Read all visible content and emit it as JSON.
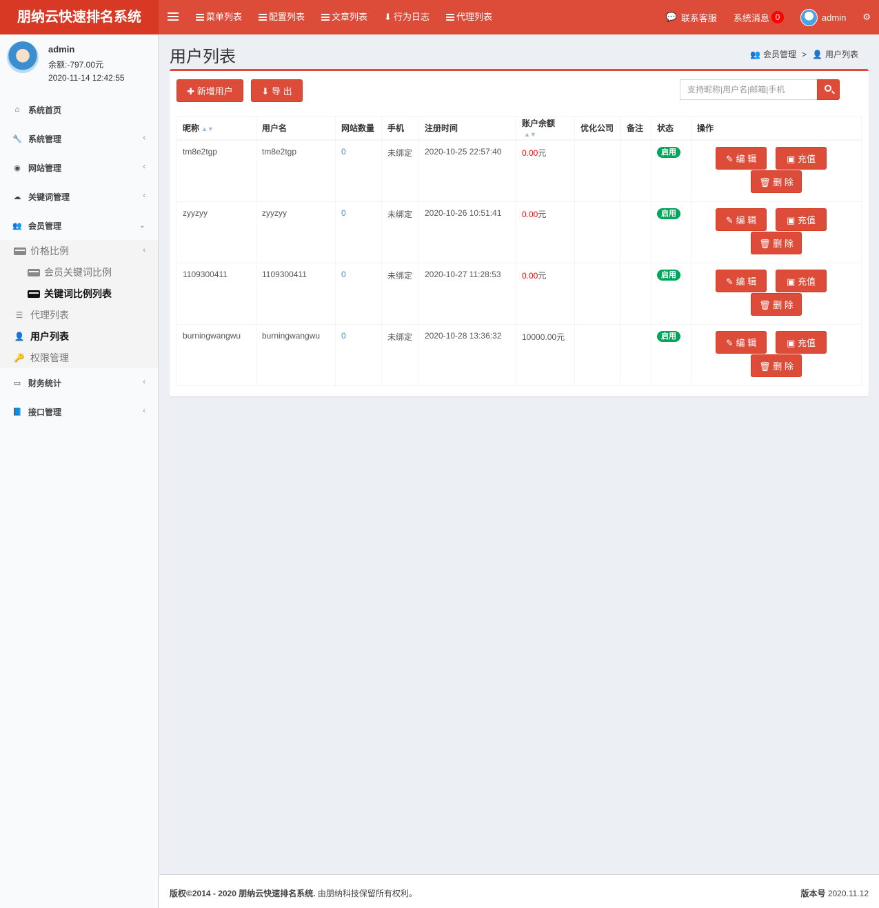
{
  "app": {
    "title": "朋纳云快速排名系统"
  },
  "topnav": {
    "items": [
      {
        "label": "菜单列表",
        "icon": "list-icon"
      },
      {
        "label": "配置列表",
        "icon": "list-icon"
      },
      {
        "label": "文章列表",
        "icon": "list-icon"
      },
      {
        "label": "行为日志",
        "icon": "download-icon"
      },
      {
        "label": "代理列表",
        "icon": "list-icon"
      }
    ],
    "contact": "联系客服",
    "messages": "系统消息",
    "message_count": "0",
    "user": "admin"
  },
  "user_panel": {
    "name": "admin",
    "balance": "余额:-797.00元",
    "time": "2020-11-14 12:42:55"
  },
  "sidebar": {
    "items": [
      {
        "label": "系统首页",
        "icon": "home-icon"
      },
      {
        "label": "系统管理",
        "icon": "wrench-icon"
      },
      {
        "label": "网站管理",
        "icon": "circle-icon"
      },
      {
        "label": "关键词管理",
        "icon": "cloud-icon"
      },
      {
        "label": "会员管理",
        "icon": "users-icon"
      }
    ],
    "member_sub": {
      "price_ratio": "价格比例",
      "member_keyword_ratio": "会员关键词比例",
      "keyword_ratio_list": "关键词比例列表",
      "agent_list": "代理列表",
      "user_list": "用户列表",
      "permission": "权限管理"
    },
    "bottom_items": [
      {
        "label": "财务统计",
        "icon": "card-icon"
      },
      {
        "label": "接口管理",
        "icon": "book-icon"
      }
    ]
  },
  "page": {
    "title": "用户列表",
    "breadcrumb": {
      "parent": "会员管理",
      "current": "用户列表"
    },
    "add_button": "新增用户",
    "export_button": "导 出",
    "search_placeholder": "支持昵称|用户名|邮箱|手机"
  },
  "table": {
    "headers": {
      "nickname": "昵称",
      "username": "用户名",
      "sites": "网站数量",
      "phone": "手机",
      "registered": "注册时间",
      "balance": "账户余额",
      "company": "优化公司",
      "remark": "备注",
      "status": "状态",
      "actions": "操作"
    },
    "rows": [
      {
        "nickname": "tm8e2tgp",
        "username": "tm8e2tgp",
        "sites": "0",
        "phone": "未绑定",
        "registered": "2020-10-25 22:57:40",
        "balance_num": "0.00",
        "balance_unit": "元",
        "status": "启用"
      },
      {
        "nickname": "zyyzyy",
        "username": "zyyzyy",
        "sites": "0",
        "phone": "未绑定",
        "registered": "2020-10-26 10:51:41",
        "balance_num": "0.00",
        "balance_unit": "元",
        "status": "启用"
      },
      {
        "nickname": "1109300411",
        "username": "1109300411",
        "sites": "0",
        "phone": "未绑定",
        "registered": "2020-10-27 11:28:53",
        "balance_num": "0.00",
        "balance_unit": "元",
        "status": "启用"
      },
      {
        "nickname": "burningwangwu",
        "username": "burningwangwu",
        "sites": "0",
        "phone": "未绑定",
        "registered": "2020-10-28 13:36:32",
        "balance_num": "10000.00",
        "balance_unit": "元",
        "status": "启用"
      }
    ],
    "actions": {
      "edit": "编 辑",
      "recharge": "充值",
      "delete": "删 除"
    }
  },
  "footer": {
    "copyright_bold": "版权©2014 - 2020 朋纳云快速排名系统.",
    "copyright_rest": " 由朋纳科技保留所有权利。",
    "version_label": "版本号",
    "version": "2020.11.12"
  },
  "colors": {
    "brand": "#dd4b39",
    "success": "#00a65a",
    "link": "#3c8dbc"
  }
}
